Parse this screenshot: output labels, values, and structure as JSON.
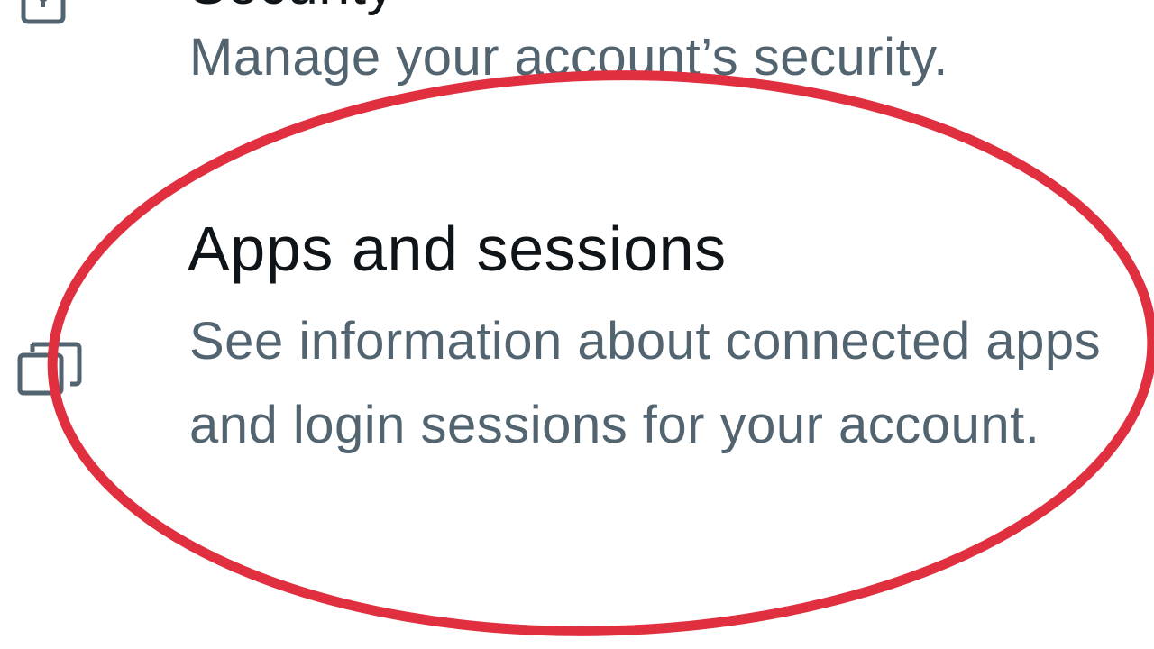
{
  "settings": {
    "items": [
      {
        "icon": "lock-icon",
        "title": "Security",
        "description": "Manage your account’s security."
      },
      {
        "icon": "stacked-windows-icon",
        "title": "Apps and sessions",
        "description": "See information about connected apps and login sessions for your account."
      }
    ]
  },
  "colors": {
    "title": "#0f1419",
    "description": "#536471",
    "icon": "#536471",
    "highlight_ring": "#e0303f",
    "background": "#ffffff"
  }
}
